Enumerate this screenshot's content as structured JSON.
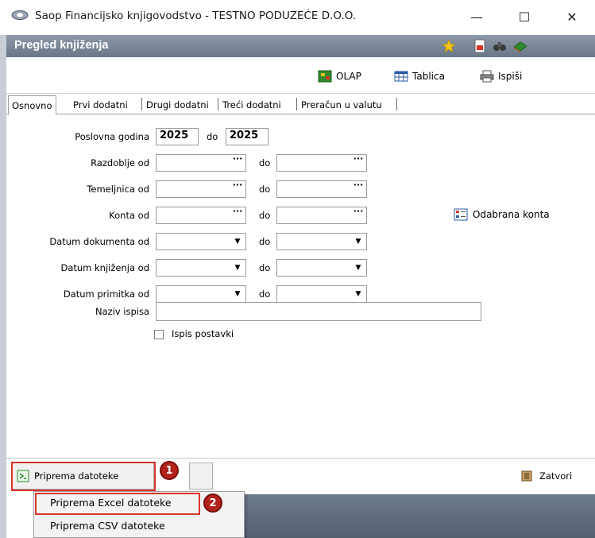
{
  "window": {
    "title": "Saop Financijsko knjigovodstvo - TESTNO PODUZEĆE D.O.O.",
    "controls": [
      "—",
      "☐",
      "✕"
    ]
  },
  "module": {
    "title": "Pregled knjiženja"
  },
  "toolbar": {
    "olap": "OLAP",
    "tablica": "Tablica",
    "ispisi": "Ispiši"
  },
  "tabs": [
    {
      "label": "Osnovno",
      "active": true
    },
    {
      "label": "Prvi dodatni",
      "active": false
    },
    {
      "label": "Drugi dodatni",
      "active": false
    },
    {
      "label": "Treći dodatni",
      "active": false
    },
    {
      "label": "Preračun u valutu",
      "active": false
    }
  ],
  "form": {
    "poslovna_godina_label": "Poslovna godina",
    "year_from": "2025",
    "do_label": "do",
    "year_to": "2025",
    "razdoblje_label": "Razdoblje od",
    "temeljnica_label": "Temeljnica od",
    "konta_label": "Konta od",
    "datum_dokumenta_label": "Datum dokumenta od",
    "datum_knjizenja_label": "Datum knjiženja od",
    "datum_primitka_label": "Datum primitka od",
    "naziv_ispisa_label": "Naziv ispisa",
    "naziv_ispisa_value": "",
    "ispis_postavki_label": "Ispis postavki",
    "ispis_postavki_checked": false,
    "odabrana_konta": "Odabrana konta",
    "lookup_glyph": "···",
    "dropdown_glyph": "▼"
  },
  "bottom": {
    "priprema_datoteke": "Priprema datoteke",
    "zatvori": "Zatvori"
  },
  "menu": {
    "excel": "Priprema Excel datoteke",
    "csv": "Priprema CSV datoteke"
  },
  "annotations": {
    "badge1": "1",
    "badge2": "2",
    "accent": "#d9342b"
  }
}
